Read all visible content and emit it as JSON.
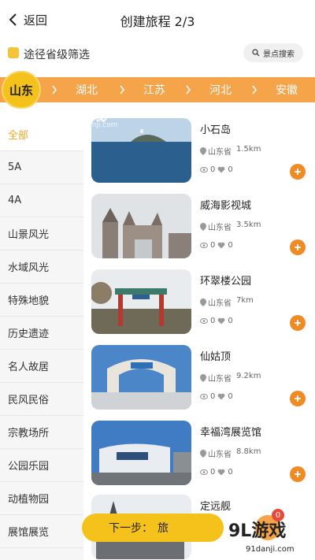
{
  "header": {
    "back_label": "返回",
    "title": "创建旅程 2/3"
  },
  "filter": {
    "label": "途径省级筛选",
    "search_label": "景点搜索"
  },
  "provinces": {
    "active": "山东",
    "items": [
      "湖北",
      "江苏",
      "河北",
      "安徽"
    ]
  },
  "categories": [
    {
      "label": "全部",
      "active": true
    },
    {
      "label": "5A"
    },
    {
      "label": "4A"
    },
    {
      "label": "山景风光"
    },
    {
      "label": "水域风光"
    },
    {
      "label": "特殊地貌"
    },
    {
      "label": "历史遗迹"
    },
    {
      "label": "名人故居"
    },
    {
      "label": "民风民俗"
    },
    {
      "label": "宗教场所"
    },
    {
      "label": "公园乐园"
    },
    {
      "label": "动植物园"
    },
    {
      "label": "展馆展览"
    }
  ],
  "attractions": [
    {
      "name": "小石岛",
      "province": "山东省",
      "distance": "1.5km",
      "views": "0",
      "likes": "0",
      "image_icon": "island-photo"
    },
    {
      "name": "威海影视城",
      "province": "山东省",
      "distance": "3.5km",
      "views": "0",
      "likes": "0",
      "image_icon": "castle-photo"
    },
    {
      "name": "环翠楼公园",
      "province": "山东省",
      "distance": "7km",
      "views": "0",
      "likes": "0",
      "image_icon": "gate-photo"
    },
    {
      "name": "仙姑顶",
      "province": "山东省",
      "distance": "9.2km",
      "views": "0",
      "likes": "0",
      "image_icon": "arch-photo"
    },
    {
      "name": "幸福湾展览馆",
      "province": "山东省",
      "distance": "8.8km",
      "views": "0",
      "likes": "0",
      "image_icon": "building-photo"
    },
    {
      "name": "定远舰",
      "image_icon": "ship-photo"
    }
  ],
  "bottom": {
    "next_label": "下一步：",
    "next_value": "旅",
    "cart_count": "0"
  },
  "watermarks": {
    "top_brand": "9L游戏",
    "top_url": "91danji.com",
    "bottom_brand": "9L游戏",
    "bottom_url": "91danji.com"
  },
  "colors": {
    "accent_orange": "#f5a44a",
    "accent_yellow": "#f5c21b",
    "add_button": "#f08a24",
    "active_category": "#f5a623"
  }
}
